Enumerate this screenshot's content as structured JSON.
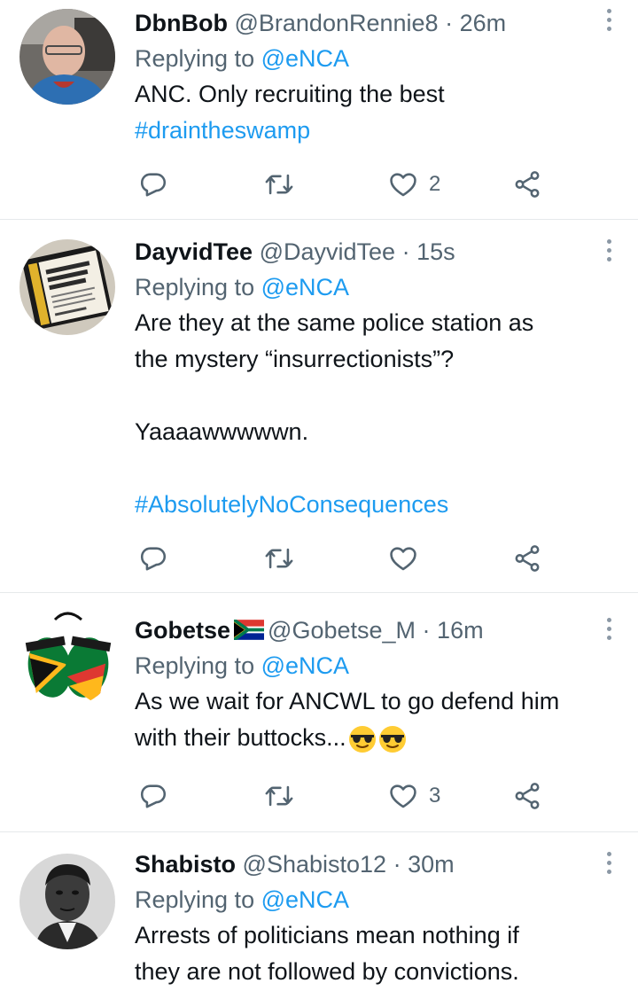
{
  "tweets": [
    {
      "name": "DbnBob",
      "handle": "@BrandonRennie8",
      "separator": "·",
      "time": "26m",
      "replying_prefix": "Replying to",
      "replying_to": "@eNCA",
      "lines": [
        "ANC. Only recruiting the best"
      ],
      "hashtag": "#draintheswamp",
      "likes": "2"
    },
    {
      "name": "DayvidTee",
      "handle": "@DayvidTee",
      "separator": "·",
      "time": "15s",
      "replying_prefix": "Replying to",
      "replying_to": "@eNCA",
      "lines": [
        "Are they at the same police station as",
        "the mystery “insurrectionists”?",
        "Yaaaawwwwwn."
      ],
      "hashtag": "#AbsolutelyNoConsequences",
      "likes": ""
    },
    {
      "name": "Gobetse",
      "handle": "@Gobetse_M",
      "separator": "·",
      "time": "16m",
      "replying_prefix": "Replying to",
      "replying_to": "@eNCA",
      "lines": [
        "As we wait for ANCWL to go defend him",
        "with their buttocks..."
      ],
      "likes": "3",
      "emoji": "smiling-face-with-sunglasses x2",
      "flag": "south-africa-flag"
    },
    {
      "name": "Shabisto",
      "handle": "@Shabisto12",
      "separator": "·",
      "time": "30m",
      "replying_prefix": "Replying to",
      "replying_to": "@eNCA",
      "lines": [
        "Arrests of politicians mean nothing if",
        "they are not followed by convictions."
      ]
    }
  ],
  "icons": {
    "reply": "reply-icon",
    "retweet": "retweet-icon",
    "like": "heart-icon",
    "share": "share-icon",
    "more": "more-options-icon"
  },
  "colors": {
    "accent": "#1d9bf0",
    "secondary_text": "#536471",
    "divider": "#e6e9eb"
  }
}
